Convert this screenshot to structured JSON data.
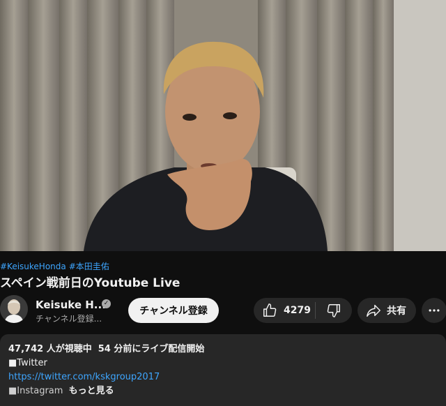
{
  "video": {
    "hashtags": [
      "#KeisukeHonda",
      "#本田圭佑"
    ],
    "title": "スペイン戦前日のYoutube Live"
  },
  "channel": {
    "name": "Keisuke H...",
    "subscribers": "チャンネル登録...",
    "verified_icon": "check-circle-icon"
  },
  "actions": {
    "subscribe_label": "チャンネル登録",
    "like_count": "4279",
    "share_label": "共有"
  },
  "description": {
    "viewers": "47,742 人が視聴中",
    "started": "54 分前にライブ配信開始",
    "line1": "■Twitter",
    "link": "https://twitter.com/kskgroup2017",
    "line3": "■Instagram",
    "more_label": "もっと見る"
  },
  "colors": {
    "accent_link": "#3ea6ff",
    "background": "#0f0f0f",
    "button_bg": "#272727"
  }
}
